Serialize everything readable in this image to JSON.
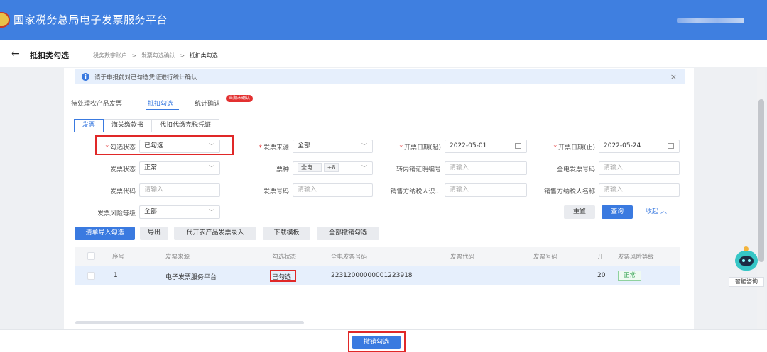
{
  "header": {
    "title": "国家税务总局电子发票服务平台"
  },
  "breadcrumb": {
    "page_title": "抵扣类勾选",
    "items": [
      "税务数字账户",
      ">",
      "发票勾选确认",
      ">",
      "抵扣类勾选"
    ]
  },
  "notice": {
    "text": "请于申报前对已勾选凭证进行统计确认"
  },
  "tabs": [
    {
      "label": "待处理农产品发票"
    },
    {
      "label": "抵扣勾选"
    },
    {
      "label": "统计确认"
    }
  ],
  "tab_badge": "当期未确认",
  "subtabs": [
    "发票",
    "海关缴款书",
    "代扣代缴完税凭证"
  ],
  "filters": {
    "select_status": {
      "label": "勾选状态",
      "value": "已勾选"
    },
    "invoice_source": {
      "label": "发票来源",
      "value": "全部"
    },
    "date_start": {
      "label": "开票日期(起)",
      "value": "2022-05-01"
    },
    "date_end": {
      "label": "开票日期(止)",
      "value": "2022-05-24"
    },
    "invoice_status": {
      "label": "发票状态",
      "value": "正常"
    },
    "invoice_kind": {
      "label": "票种",
      "tag1": "全电...",
      "tag2": "+8"
    },
    "transfer_no": {
      "label": "转内销证明编号",
      "placeholder": "请输入"
    },
    "full_invoice_no": {
      "label": "全电发票号码",
      "placeholder": "请输入"
    },
    "invoice_code": {
      "label": "发票代码",
      "placeholder": "请输入"
    },
    "invoice_number": {
      "label": "发票号码",
      "placeholder": "请输入"
    },
    "seller_tax_id": {
      "label": "销售方纳税人识...",
      "placeholder": "请输入"
    },
    "seller_name": {
      "label": "销售方纳税人名称",
      "placeholder": "请输入"
    },
    "risk_level": {
      "label": "发票风险等级",
      "value": "全部"
    }
  },
  "actions": {
    "reset": "重置",
    "query": "查询",
    "collapse": "收起"
  },
  "toolbar": [
    "清单导入勾选",
    "导出",
    "代开农产品发票录入",
    "下载模板",
    "全部撤销勾选"
  ],
  "table": {
    "columns": [
      "序号",
      "发票来源",
      "勾选状态",
      "全电发票号码",
      "发票代码",
      "发票号码",
      "开",
      "发票风险等级"
    ],
    "rows": [
      {
        "index": "1",
        "source": "电子发票服务平台",
        "status": "已勾选",
        "full_no": "22312000000001223918",
        "code": "",
        "number": "",
        "date": "20",
        "risk": "正常"
      }
    ]
  },
  "footer": {
    "cancel_label": "撤销勾选"
  },
  "assistant": {
    "label": "智能咨询"
  }
}
